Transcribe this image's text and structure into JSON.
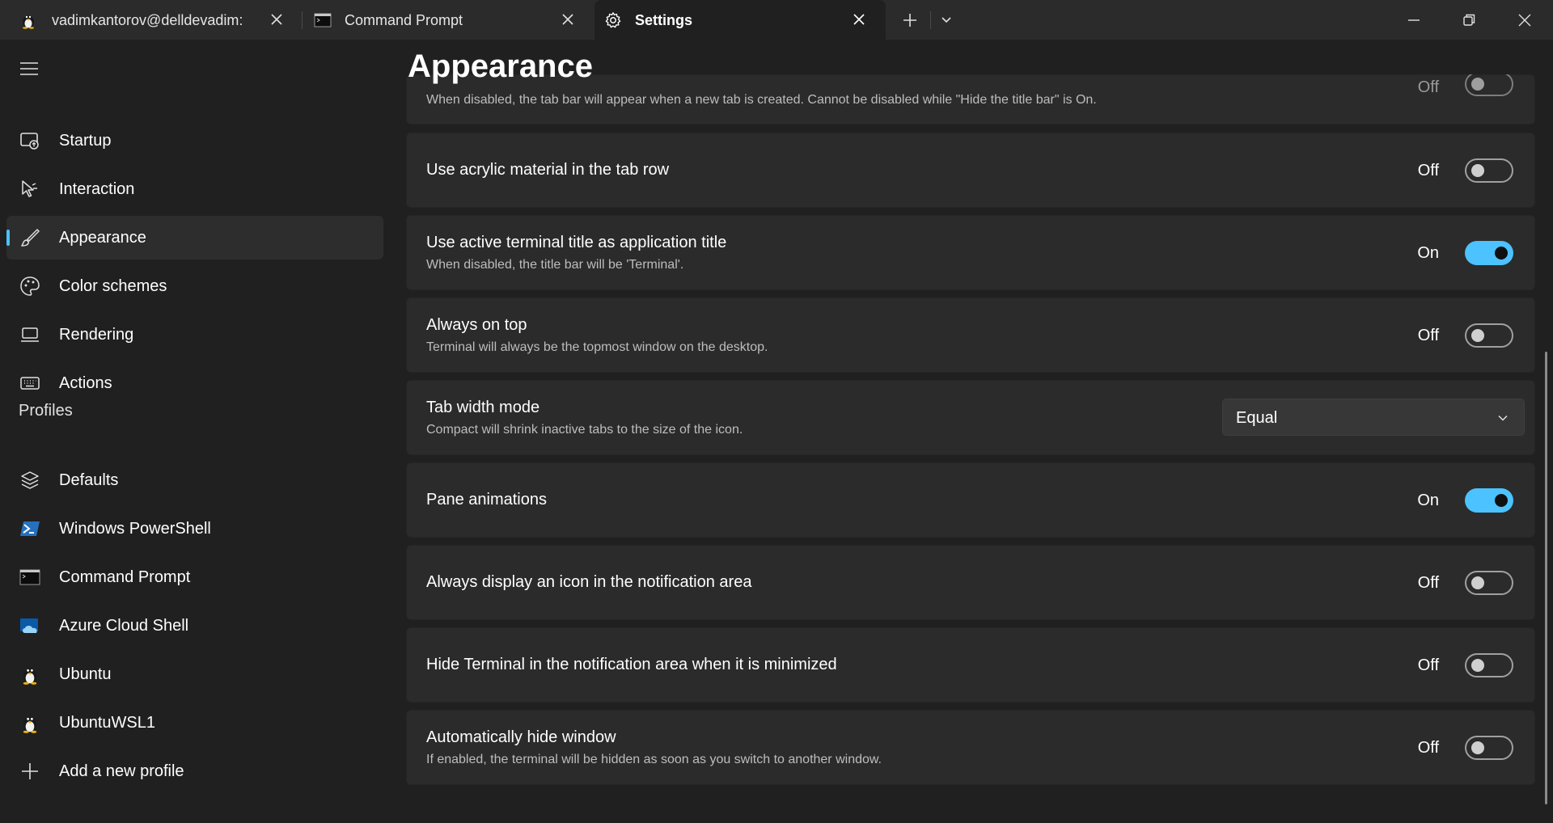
{
  "tabs": [
    {
      "label": "vadimkantorov@delldevadim: ",
      "icon": "tux-icon"
    },
    {
      "label": "Command Prompt",
      "icon": "terminal-icon"
    },
    {
      "label": "Settings",
      "icon": "gear-icon"
    }
  ],
  "sidebar": {
    "items": [
      {
        "label": "Startup",
        "icon": "startup-icon"
      },
      {
        "label": "Interaction",
        "icon": "cursor-icon"
      },
      {
        "label": "Appearance",
        "icon": "paintbrush-icon"
      },
      {
        "label": "Color schemes",
        "icon": "palette-icon"
      },
      {
        "label": "Rendering",
        "icon": "monitor-icon"
      },
      {
        "label": "Actions",
        "icon": "keyboard-icon"
      }
    ],
    "profiles_header": "Profiles",
    "profiles": [
      {
        "label": "Defaults",
        "icon": "layers-icon"
      },
      {
        "label": "Windows PowerShell",
        "icon": "powershell-icon"
      },
      {
        "label": "Command Prompt",
        "icon": "terminal-icon"
      },
      {
        "label": "Azure Cloud Shell",
        "icon": "azure-cloud-icon"
      },
      {
        "label": "Ubuntu",
        "icon": "tux-icon"
      },
      {
        "label": "UbuntuWSL1",
        "icon": "tux-icon"
      },
      {
        "label": "Add a new profile",
        "icon": "plus-icon"
      }
    ]
  },
  "main": {
    "title": "Appearance",
    "settings": [
      {
        "title": "",
        "desc": "When disabled, the tab bar will appear when a new tab is created. Cannot be disabled while \"Hide the title bar\" is On.",
        "state": "Off",
        "on": false
      },
      {
        "title": "Use acrylic material in the tab row",
        "desc": "",
        "state": "Off",
        "on": false
      },
      {
        "title": "Use active terminal title as application title",
        "desc": "When disabled, the title bar will be 'Terminal'.",
        "state": "On",
        "on": true
      },
      {
        "title": "Always on top",
        "desc": "Terminal will always be the topmost window on the desktop.",
        "state": "Off",
        "on": false
      },
      {
        "title": "Tab width mode",
        "desc": "Compact will shrink inactive tabs to the size of the icon.",
        "dropdown_value": "Equal"
      },
      {
        "title": "Pane animations",
        "desc": "",
        "state": "On",
        "on": true
      },
      {
        "title": "Always display an icon in the notification area",
        "desc": "",
        "state": "Off",
        "on": false
      },
      {
        "title": "Hide Terminal in the notification area when it is minimized",
        "desc": "",
        "state": "Off",
        "on": false
      },
      {
        "title": "Automatically hide window",
        "desc": "If enabled, the terminal will be hidden as soon as you switch to another window.",
        "state": "Off",
        "on": false
      }
    ]
  },
  "colors": {
    "accent": "#4cc2ff",
    "background": "#202020",
    "card": "#2b2b2b"
  }
}
